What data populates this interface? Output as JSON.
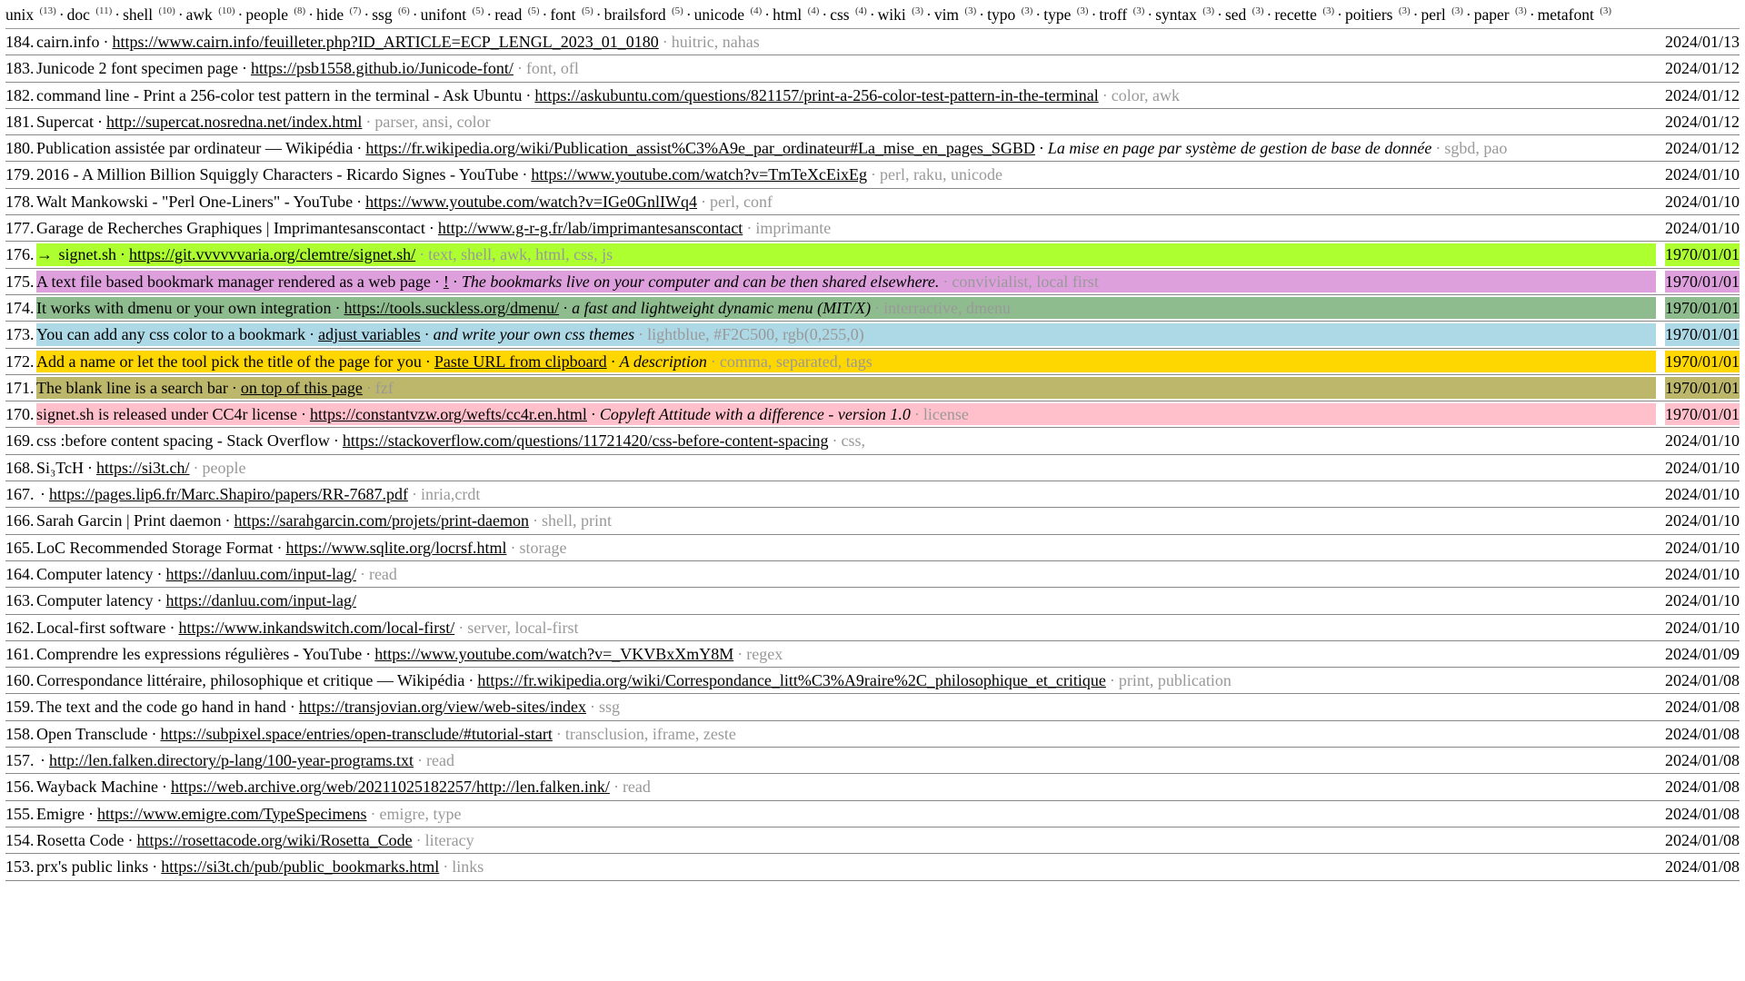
{
  "tags": [
    {
      "name": "unix",
      "count": 13
    },
    {
      "name": "doc",
      "count": 11
    },
    {
      "name": "shell",
      "count": 10
    },
    {
      "name": "awk",
      "count": 10
    },
    {
      "name": "people",
      "count": 8
    },
    {
      "name": "hide",
      "count": 7
    },
    {
      "name": "ssg",
      "count": 6
    },
    {
      "name": "unifont",
      "count": 5
    },
    {
      "name": "read",
      "count": 5
    },
    {
      "name": "font",
      "count": 5
    },
    {
      "name": "brailsford",
      "count": 5
    },
    {
      "name": "unicode",
      "count": 4
    },
    {
      "name": "html",
      "count": 4
    },
    {
      "name": "css",
      "count": 4
    },
    {
      "name": "wiki",
      "count": 3
    },
    {
      "name": "vim",
      "count": 3
    },
    {
      "name": "typo",
      "count": 3
    },
    {
      "name": "type",
      "count": 3
    },
    {
      "name": "troff",
      "count": 3
    },
    {
      "name": "syntax",
      "count": 3
    },
    {
      "name": "sed",
      "count": 3
    },
    {
      "name": "recette",
      "count": 3
    },
    {
      "name": "poitiers",
      "count": 3
    },
    {
      "name": "perl",
      "count": 3
    },
    {
      "name": "paper",
      "count": 3
    },
    {
      "name": "metafont",
      "count": 3
    }
  ],
  "items": [
    {
      "n": 184,
      "name": "cairn.info",
      "url": "https://www.cairn.info/feuilleter.php?ID_ARTICLE=ECP_LENGL_2023_01_0180",
      "desc": "",
      "tags": "huitric, nahas",
      "date": "2024/01/13"
    },
    {
      "n": 183,
      "name": "Junicode 2 font specimen page",
      "url": "https://psb1558.github.io/Junicode-font/",
      "desc": "",
      "tags": "font, ofl",
      "date": "2024/01/12"
    },
    {
      "n": 182,
      "name": "command line - Print a 256-color test pattern in the terminal - Ask Ubuntu",
      "url": "https://askubuntu.com/questions/821157/print-a-256-color-test-pattern-in-the-terminal",
      "desc": "",
      "tags": "color, awk",
      "date": "2024/01/12"
    },
    {
      "n": 181,
      "name": "Supercat",
      "url": "http://supercat.nosredna.net/index.html",
      "desc": "",
      "tags": "parser, ansi, color",
      "date": "2024/01/12"
    },
    {
      "n": 180,
      "name": "Publication assistée par ordinateur — Wikipédia",
      "url": "https://fr.wikipedia.org/wiki/Publication_assist%C3%A9e_par_ordinateur#La_mise_en_pages_SGBD",
      "desc": "La mise en page par système de gestion de base de donnée",
      "tags": "sgbd, pao",
      "date": "2024/01/12"
    },
    {
      "n": 179,
      "name": "2016 - A Million Billion Squiggly Characters - Ricardo Signes - YouTube",
      "url": "https://www.youtube.com/watch?v=TmTeXcEixEg",
      "desc": "",
      "tags": "perl, raku, unicode",
      "date": "2024/01/10"
    },
    {
      "n": 178,
      "name": "Walt Mankowski - \"Perl One-Liners\" - YouTube",
      "url": "https://www.youtube.com/watch?v=IGe0GnlIWq4",
      "desc": "",
      "tags": "perl, conf",
      "date": "2024/01/10"
    },
    {
      "n": 177,
      "name": "Garage de Recherches Graphiques | Imprimantesanscontact",
      "url": "http://www.g-r-g.fr/lab/imprimantesanscontact",
      "desc": "",
      "tags": "imprimante",
      "date": "2024/01/10"
    },
    {
      "n": 176,
      "arrow": true,
      "name": "signet.sh",
      "url": "https://git.vvvvvvaria.org/clemtre/signet.sh/",
      "desc": "",
      "tags": "text, shell, awk, html, css, js",
      "date": "1970/01/01",
      "hl": "greenyellow"
    },
    {
      "n": 175,
      "name": "A text file based bookmark manager rendered as a web page",
      "url": "!",
      "desc": "The bookmarks live on your computer and can be then shared elsewhere.",
      "tags": "convivialist, local first",
      "date": "1970/01/01",
      "hl": "plum"
    },
    {
      "n": 174,
      "name": "It works with dmenu or your own integration",
      "url": "https://tools.suckless.org/dmenu/",
      "desc": "a fast and lightweight dynamic menu (MIT/X)",
      "tags": "interractive, dmenu",
      "date": "1970/01/01",
      "hl": "darkseagreen"
    },
    {
      "n": 173,
      "name": "You can add any css color to a bookmark",
      "url": "adjust variables",
      "desc": "and write your own css themes",
      "tags": "lightblue, #F2C500, rgb(0,255,0)",
      "date": "1970/01/01",
      "hl": "lightblue"
    },
    {
      "n": 172,
      "name": "Add a name or let the tool pick the title of the page for you",
      "url": "Paste URL from clipboard",
      "desc": "A description",
      "tags": "comma, separated, tags",
      "date": "1970/01/01",
      "hl": "gold"
    },
    {
      "n": 171,
      "name": "The blank line is a search bar",
      "url": "on top of this page",
      "desc": "",
      "tags": "fzf",
      "date": "1970/01/01",
      "hl": "darkkhaki"
    },
    {
      "n": 170,
      "name": "signet.sh is released under CC4r license",
      "url": "https://constantvzw.org/wefts/cc4r.en.html",
      "desc": "Copyleft Attitude with a difference - version 1.0",
      "tags": "license",
      "date": "1970/01/01",
      "hl": "pink"
    },
    {
      "n": 169,
      "name": "css :before content spacing - Stack Overflow",
      "url": "https://stackoverflow.com/questions/11721420/css-before-content-spacing",
      "desc": "",
      "tags": "css,",
      "date": "2024/01/10"
    },
    {
      "n": 168,
      "name": "Si₃TcH",
      "url": "https://si3t.ch/",
      "desc": "",
      "tags": "people",
      "date": "2024/01/10"
    },
    {
      "n": 167,
      "name": "",
      "url": "https://pages.lip6.fr/Marc.Shapiro/papers/RR-7687.pdf",
      "desc": "",
      "tags": "inria,crdt",
      "date": "2024/01/10"
    },
    {
      "n": 166,
      "name": "Sarah Garcin | Print daemon",
      "url": "https://sarahgarcin.com/projets/print-daemon",
      "desc": "",
      "tags": "shell, print",
      "date": "2024/01/10"
    },
    {
      "n": 165,
      "name": "LoC Recommended Storage Format",
      "url": "https://www.sqlite.org/locrsf.html",
      "desc": "",
      "tags": "storage",
      "date": "2024/01/10"
    },
    {
      "n": 164,
      "name": "Computer latency",
      "url": "https://danluu.com/input-lag/",
      "desc": "",
      "tags": "read",
      "date": "2024/01/10"
    },
    {
      "n": 163,
      "name": "Computer latency",
      "url": "https://danluu.com/input-lag/",
      "desc": "",
      "tags": "",
      "date": "2024/01/10"
    },
    {
      "n": 162,
      "name": "Local-first software",
      "url": "https://www.inkandswitch.com/local-first/",
      "desc": "",
      "tags": "server, local-first",
      "date": "2024/01/10"
    },
    {
      "n": 161,
      "name": "Comprendre les expressions régulières - YouTube",
      "url": "https://www.youtube.com/watch?v=_VKVBxXmY8M",
      "desc": "",
      "tags": "regex",
      "date": "2024/01/09"
    },
    {
      "n": 160,
      "name": "Correspondance littéraire, philosophique et critique — Wikipédia",
      "url": "https://fr.wikipedia.org/wiki/Correspondance_litt%C3%A9raire%2C_philosophique_et_critique",
      "desc": "",
      "tags": "print, publication",
      "date": "2024/01/08"
    },
    {
      "n": 159,
      "name": "The text and the code go hand in hand",
      "url": "https://transjovian.org/view/web-sites/index",
      "desc": "",
      "tags": "ssg",
      "date": "2024/01/08"
    },
    {
      "n": 158,
      "name": "Open Transclude",
      "url": "https://subpixel.space/entries/open-transclude/#tutorial-start",
      "desc": "",
      "tags": "transclusion, iframe, zeste",
      "date": "2024/01/08"
    },
    {
      "n": 157,
      "name": "",
      "url": "http://len.falken.directory/p-lang/100-year-programs.txt",
      "desc": "",
      "tags": "read",
      "date": "2024/01/08"
    },
    {
      "n": 156,
      "name": "Wayback Machine",
      "url": "https://web.archive.org/web/20211025182257/http://len.falken.ink/",
      "desc": "",
      "tags": "read",
      "date": "2024/01/08"
    },
    {
      "n": 155,
      "name": "Emigre",
      "url": "https://www.emigre.com/TypeSpecimens",
      "desc": "",
      "tags": "emigre, type",
      "date": "2024/01/08"
    },
    {
      "n": 154,
      "name": "Rosetta Code",
      "url": "https://rosettacode.org/wiki/Rosetta_Code",
      "desc": "",
      "tags": "literacy",
      "date": "2024/01/08"
    },
    {
      "n": 153,
      "name": "prx's public links",
      "url": "https://si3t.ch/pub/public_bookmarks.html",
      "desc": "",
      "tags": "links",
      "date": "2024/01/08"
    }
  ]
}
